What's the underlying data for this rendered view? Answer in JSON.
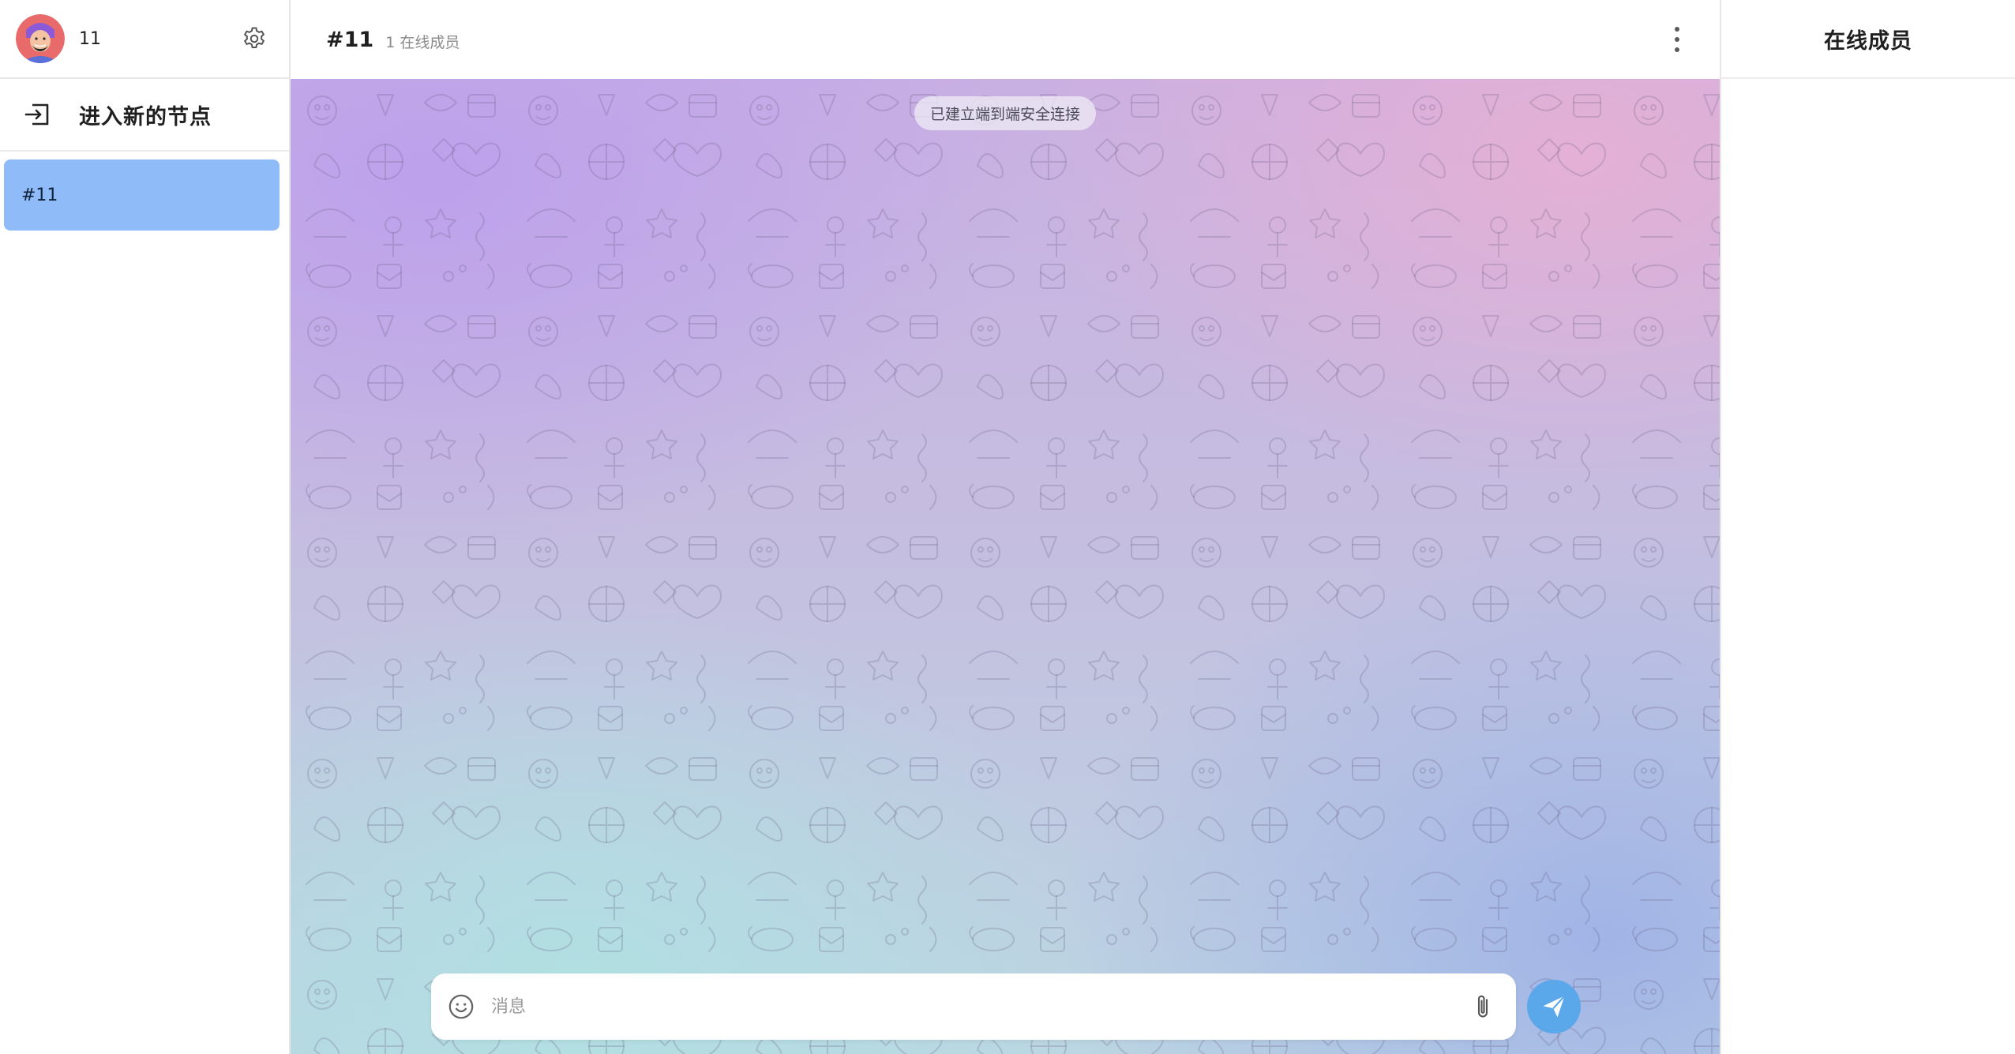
{
  "user": {
    "name": "11",
    "avatar": "avatar-bearded-man"
  },
  "sidebar": {
    "join_label": "进入新的节点",
    "nodes": [
      {
        "label": "#11",
        "selected": true
      }
    ]
  },
  "chat": {
    "channel_name": "#11",
    "member_count": "1 在线成员",
    "e2e_notice": "已建立端到端安全连接",
    "composer": {
      "placeholder": "消息",
      "value": ""
    }
  },
  "members_panel": {
    "title": "在线成员"
  },
  "icons": {
    "settings": "gear-icon",
    "join": "enter-icon",
    "menu": "kebab-menu-icon",
    "emoji": "smile-icon",
    "attach": "paperclip-icon",
    "send": "paper-plane-icon"
  },
  "colors": {
    "selected_node_bg": "#8fbcf8",
    "send_button": "#5aa7ea",
    "background_gradient": [
      "#bca0ec",
      "#e6b0d4",
      "#b0e0e2",
      "#a0b2e6"
    ]
  }
}
